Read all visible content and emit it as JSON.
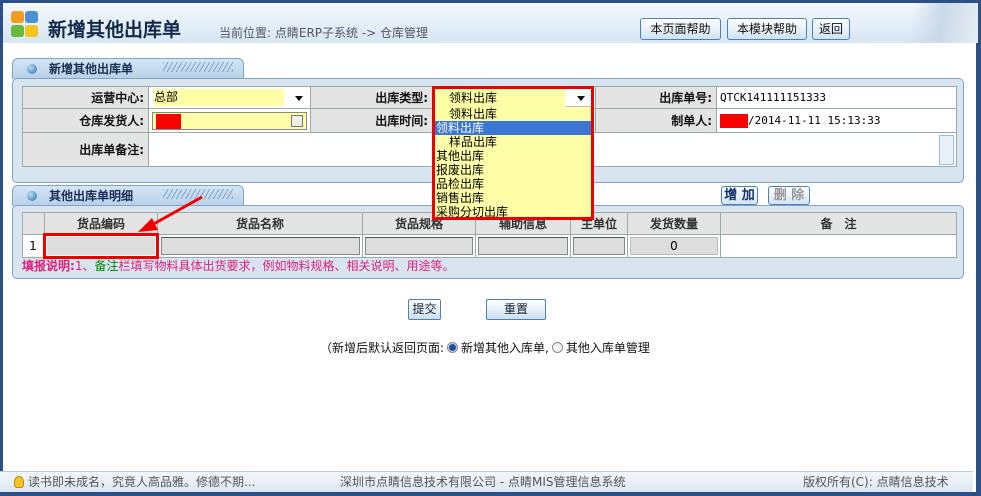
{
  "header": {
    "title": "新增其他出库单",
    "breadcrumb": "当前位置: 点睛ERP子系统 -> 仓库管理",
    "buttons": [
      "本页面帮助",
      "本模块帮助",
      "返回"
    ]
  },
  "panel1": {
    "title": "新增其他出库单",
    "fields": {
      "ops_center_label": "运营中心:",
      "ops_center_value": "总部",
      "type_label": "出库类型:",
      "type_value": "领料出库",
      "order_no_label": "出库单号:",
      "order_no_value": "QTCK141111151333",
      "shipper_label": "仓库发货人:",
      "time_label": "出库时间:",
      "creator_label": "制单人:",
      "creator_value": "/2014-11-11 15:13:33",
      "remark_label": "出库单备注:"
    }
  },
  "dropdown": {
    "options": [
      "领料出库",
      "领料出库",
      "样品出库",
      "其他出库",
      "报废出库",
      "品检出库",
      "销售出库",
      "采购分切出库"
    ],
    "highlighted_index": 1
  },
  "panel2": {
    "title": "其他出库单明细",
    "add_label": "增 加",
    "delete_label": "删 除",
    "columns": [
      "货品编码",
      "货品名称",
      "货品规格",
      "辅助信息",
      "主单位",
      "发货数量",
      "备　注"
    ],
    "rows": [
      {
        "num": "1",
        "qty": "0"
      }
    ],
    "note_label": "填报说明:",
    "note_prefix": "1、",
    "note_field": "备注",
    "note_text": "栏填写物料具体出货要求，例如物料规格、相关说明、用途等。"
  },
  "actions": {
    "submit": "提交",
    "reset": "重置"
  },
  "return_option": {
    "label": "（新增后默认返回页面:",
    "opt1": "新增其他入库单,",
    "opt2": "其他入库单管理",
    "selected": "opt1"
  },
  "footer": {
    "quote": "读书即未成名，究竟人高品雅。修德不期...",
    "company": "深圳市点睛信息技术有限公司 - 点睛MIS管理信息系统",
    "copyright": "版权所有(C): 点睛信息技术"
  },
  "colors": {
    "highlight_red": "#ee0000",
    "field_yellow": "#ffffa8",
    "note_pink": "#e0207a"
  }
}
